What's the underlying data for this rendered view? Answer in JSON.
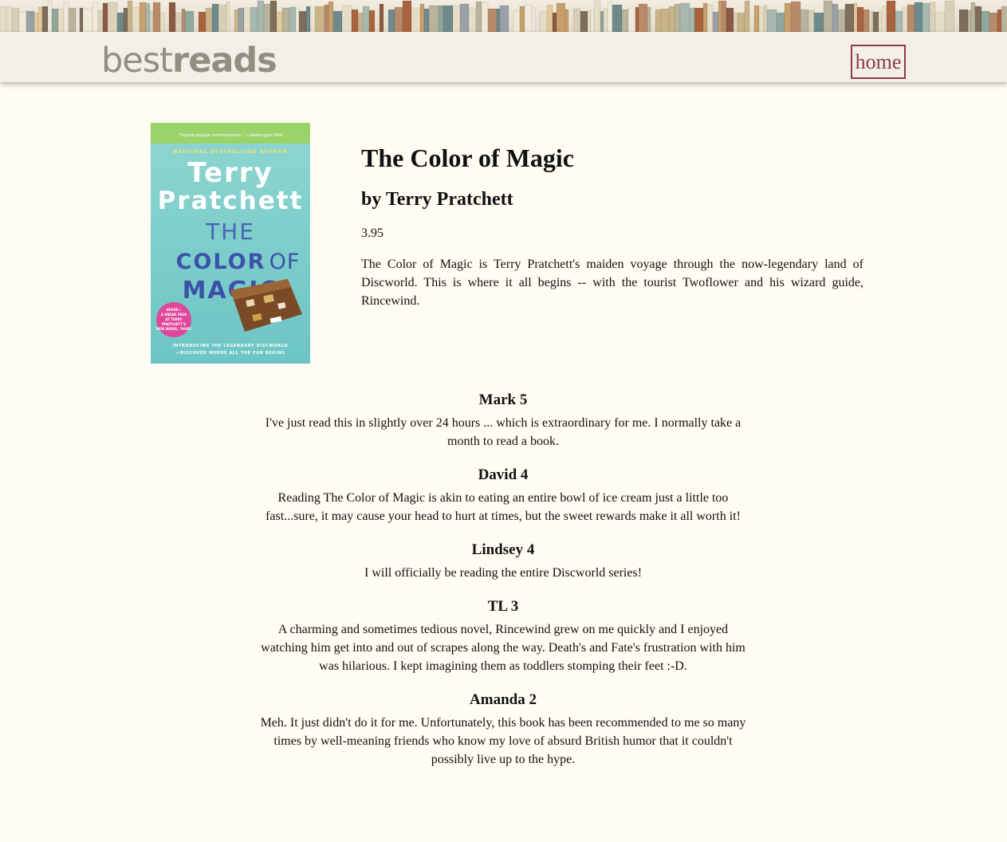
{
  "header": {
    "logo_light": "best",
    "logo_bold": "reads",
    "home_label": "home"
  },
  "cover": {
    "quote": "\"Superb popular entertainment.\" —Washington Post",
    "banner": "NATIONAL BESTSELLING AUTHOR",
    "author_line1": "Terry",
    "author_line2": "Pratchett",
    "title_line1": "THE",
    "title_line2a": "COLOR",
    "title_line2b": "OF",
    "title_line3": "MAGIC",
    "badge": "INSIDE— A SNEAK PEEK AT TERRY PRATCHETT'S NEW NOVEL, THUD!",
    "footer_line1": "INTRODUCING THE LEGENDARY DISCWORLD",
    "footer_line2": "—DISCOVER WHERE ALL THE FUN BEGINS"
  },
  "book": {
    "title": "The Color of Magic",
    "author": "by Terry Pratchett",
    "rating": "3.95",
    "description": "The Color of Magic is Terry Pratchett's maiden voyage through the now-legendary land of Discworld. This is where it all begins -- with the tourist Twoflower and his wizard guide, Rincewind."
  },
  "reviews": [
    {
      "heading": "Mark 5",
      "text": "I've just read this in slightly over 24 hours ... which is extraordinary for me. I normally take a month to read a book."
    },
    {
      "heading": "David 4",
      "text": "Reading The Color of Magic is akin to eating an entire bowl of ice cream just a little too fast...sure, it may cause your head to hurt at times, but the sweet rewards make it all worth it!"
    },
    {
      "heading": "Lindsey 4",
      "text": "I will officially be reading the entire Discworld series!"
    },
    {
      "heading": "TL 3",
      "text": "A charming and sometimes tedious novel, Rincewind grew on me quickly and I enjoyed watching him get into and out of scrapes along the way. Death's and Fate's frustration with him was hilarious. I kept imagining them as toddlers stomping their feet :-D."
    },
    {
      "heading": "Amanda 2",
      "text": "Meh. It just didn't do it for me. Unfortunately, this book has been recommended to me so many times by well-meaning friends who know my love of absurd British humor that it couldn't possibly live up to the hype."
    }
  ],
  "colors": {
    "background": "#fffcf3",
    "header_bar": "#f1efe8",
    "logo": "#908f80",
    "home_accent": "#8e3b47"
  }
}
